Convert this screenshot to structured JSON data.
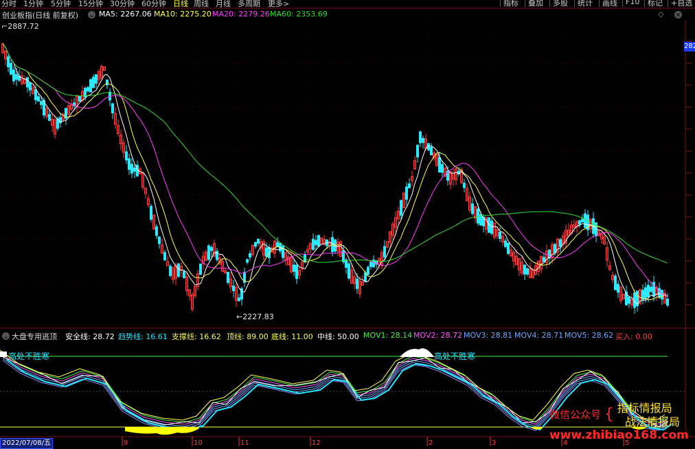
{
  "periods": [
    "分时",
    "1分钟",
    "5分钟",
    "15分钟",
    "30分钟",
    "60分钟",
    "日线",
    "周线",
    "月线",
    "多周期",
    "更多>"
  ],
  "active_period": "日线",
  "tools": [
    "指标",
    "叠加",
    "多股",
    "统计",
    "画线",
    "F10",
    "标记",
    "+自选"
  ],
  "main_legend": {
    "title": "创业板指(日线 前复权)",
    "ma5": "MA5: 2267.06",
    "ma10": "MA10: 2275.20",
    "ma20": "MA20: 2279.26",
    "ma60": "MA60: 2353.69"
  },
  "price_high_label": "2887.72",
  "price_low_label": "2227.83",
  "right_axis_label": "282",
  "ind_legend": {
    "title": "大盘专用逃顶",
    "safe": "安全线: 28.72",
    "trend": "趋势线: 16.61",
    "support": "支撑线: 16.62",
    "top": "顶线: 89.00",
    "bottom": "底线: 11.00",
    "mid": "中线: 50.00",
    "mov1": "MOV1: 28.14",
    "mov2": "MOV2: 28.72",
    "mov3": "MOV3: 28.81",
    "mov4": "MOV4: 28.71",
    "mov5": "MOV5: 28.62",
    "buy": "买入: 0.00"
  },
  "signal_left": "高处不胜寒",
  "signal_right": "高处不胜寒",
  "date_box": "2022/07/08/五",
  "x_labels": [
    "9",
    "10",
    "11",
    "12",
    "2",
    "3",
    "4",
    "5"
  ],
  "watermark": {
    "line1_prefix": "微信公众号",
    "line1_brand": "指标情报局",
    "line2": "战法情报局",
    "url": "www.zhibiao168.com"
  },
  "colors": {
    "up": "#ff3b3b",
    "down": "#2ee8ff",
    "ma5": "#ffffff",
    "ma10": "#ffff55",
    "ma20": "#ff3cff",
    "ma60": "#33dd33",
    "grid": "#7a1010"
  }
}
